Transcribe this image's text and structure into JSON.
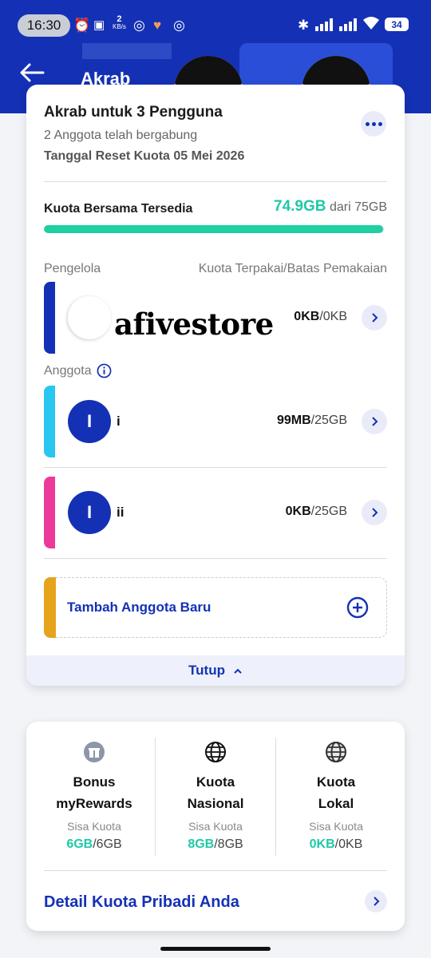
{
  "status_bar": {
    "time": "16:30",
    "net_speed_value": "2",
    "net_speed_unit": "KB/s",
    "battery": "34"
  },
  "header": {
    "title": "Akrab"
  },
  "plan": {
    "title": "Akrab untuk 3 Pengguna",
    "members_joined": "2 Anggota telah bergabung",
    "reset_date": "Tanggal Reset Kuota 05 Mei 2026"
  },
  "shared_quota": {
    "label": "Kuota Bersama Tersedia",
    "available": "74.9GB",
    "of_text": "dari 75GB",
    "fraction_available": 0.9987
  },
  "sections": {
    "manager_label": "Pengelola",
    "usage_header": "Kuota Terpakai/Batas Pemakaian",
    "members_label": "Anggota"
  },
  "manager": {
    "name": "afivestore",
    "used": "0KB",
    "limit": "/0KB",
    "stripe_color": "#1431b5"
  },
  "members": [
    {
      "initial": "I",
      "name": "i",
      "used": "99MB",
      "limit": "/25GB",
      "stripe_color": "#29c6f0"
    },
    {
      "initial": "I",
      "name": "ii",
      "used": "0KB",
      "limit": "/25GB",
      "stripe_color": "#ec3a9b"
    }
  ],
  "add_member": {
    "label": "Tambah Anggota Baru"
  },
  "close_label": "Tutup",
  "personal_quota": [
    {
      "icon": "gift-icon",
      "name_line1": "Bonus",
      "name_line2": "myRewards",
      "sub": "Sisa Kuota",
      "remaining": "6GB",
      "total": "/6GB"
    },
    {
      "icon": "globe-icon",
      "name_line1": "Kuota",
      "name_line2": "Nasional",
      "sub": "Sisa Kuota",
      "remaining": "8GB",
      "total": "/8GB"
    },
    {
      "icon": "globe-icon",
      "name_line1": "Kuota",
      "name_line2": "Lokal",
      "sub": "Sisa Kuota",
      "remaining": "0KB",
      "total": "/0KB"
    }
  ],
  "detail_link": "Detail Kuota Pribadi Anda",
  "colors": {
    "brand_blue": "#1431b5",
    "accent_green": "#1fc9a8",
    "add_stripe": "#e6a41d"
  }
}
